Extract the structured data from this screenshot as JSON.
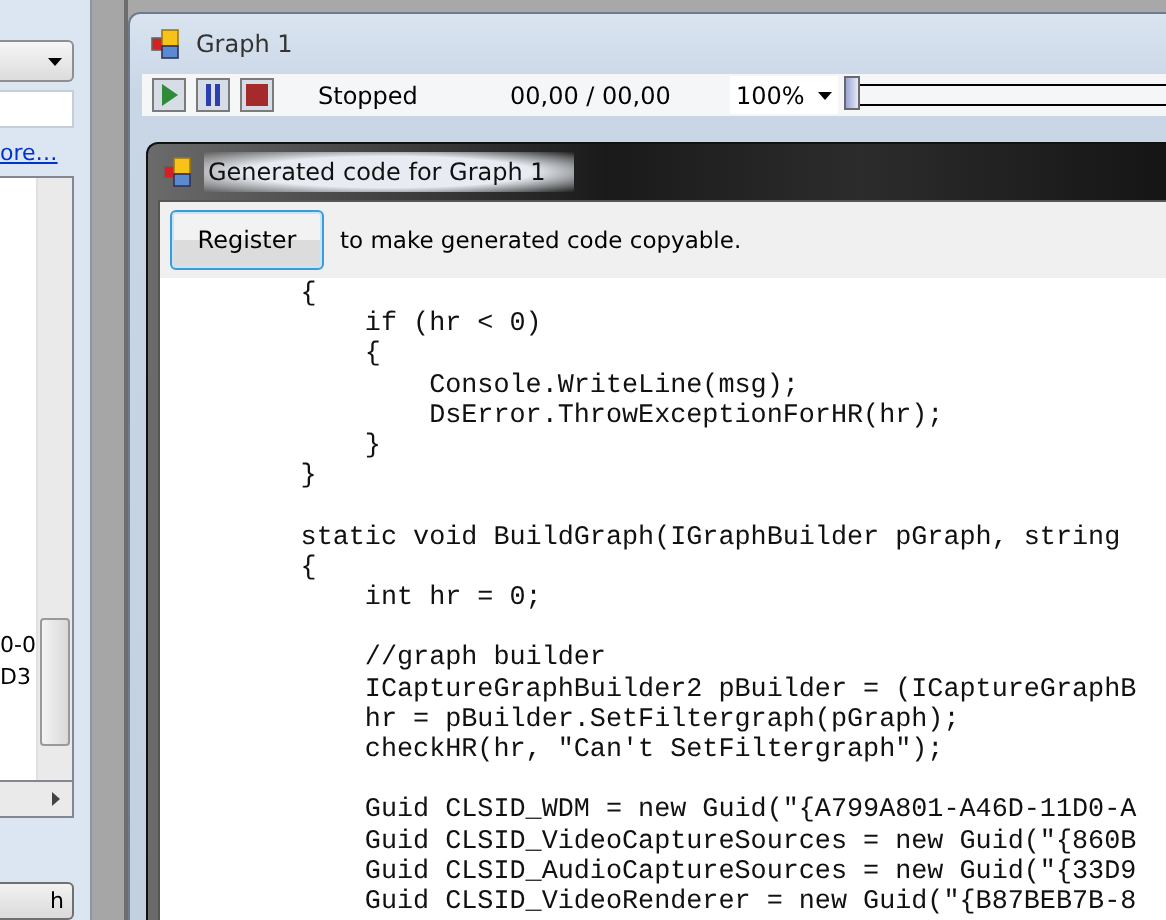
{
  "side_panel": {
    "link": "ore…",
    "list_items": [
      "0-0",
      "D3"
    ],
    "button": "h"
  },
  "graph_window": {
    "title": "Graph 1",
    "toolbar": {
      "buttons": [
        {
          "kind": "play"
        },
        {
          "kind": "pause"
        },
        {
          "kind": "stop"
        }
      ],
      "status": "Stopped",
      "time": "00,00 / 00,00",
      "zoom": "100%",
      "slider": {
        "level": 0
      }
    }
  },
  "code_dialog": {
    "title": "Generated code for Graph 1",
    "register_button": "Register",
    "register_hint": "to make generated code copyable.",
    "code": "        {\n            if (hr < 0)\n            {\n                Console.WriteLine(msg);\n                DsError.ThrowExceptionForHR(hr);\n            }\n        }\n\n        static void BuildGraph(IGraphBuilder pGraph, string\n        {\n            int hr = 0;\n\n            //graph builder\n            ICaptureGraphBuilder2 pBuilder = (ICaptureGraphB\n            hr = pBuilder.SetFiltergraph(pGraph);\n            checkHR(hr, \"Can't SetFiltergraph\");\n\n            Guid CLSID_WDM = new Guid(\"{A799A801-A46D-11D0-A\n            Guid CLSID_VideoCaptureSources = new Guid(\"{860B\n            Guid CLSID_AudioCaptureSources = new Guid(\"{33D9\n            Guid CLSID_VideoRenderer = new Guid(\"{B87BEB7B-8"
  }
}
